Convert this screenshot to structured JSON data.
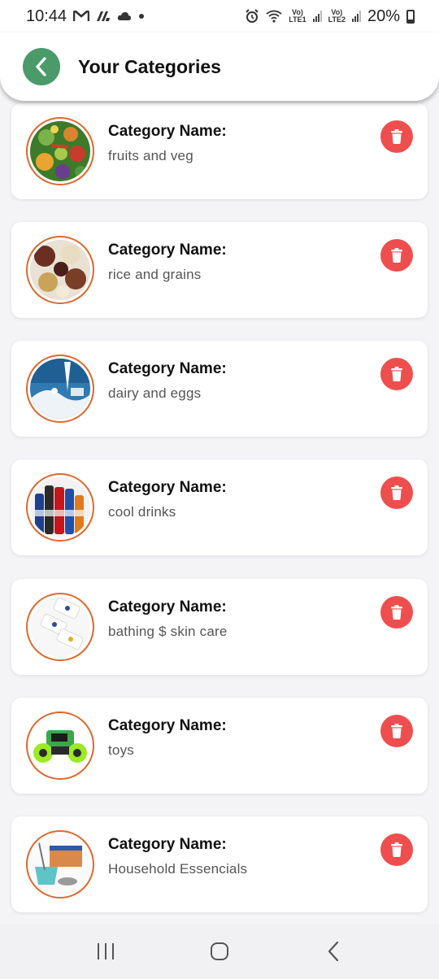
{
  "status_bar": {
    "time": "10:44",
    "left_icons": [
      "gmail-m-icon",
      "app-icon",
      "cloud-icon",
      "dot-icon"
    ],
    "sim1_label_top": "Vo)",
    "sim1_label_bottom": "LTE1",
    "sim2_label_top": "Vo)",
    "sim2_label_bottom": "LTE2",
    "battery": "20%"
  },
  "app_bar": {
    "title": "Your Categories",
    "back_icon": "chevron-left-icon",
    "accent_color": "#4a9a6a"
  },
  "categories": [
    {
      "label": "Category Name:",
      "name": "fruits and veg"
    },
    {
      "label": "Category Name:",
      "name": "rice and grains"
    },
    {
      "label": "Category Name:",
      "name": "dairy and eggs"
    },
    {
      "label": "Category Name:",
      "name": "cool drinks"
    },
    {
      "label": "Category Name:",
      "name": "bathing $ skin care"
    },
    {
      "label": "Category Name:",
      "name": "toys"
    },
    {
      "label": "Category Name:",
      "name": "Household Essencials"
    }
  ],
  "colors": {
    "delete": "#ef4e4e",
    "thumb_border": "#e0682c"
  },
  "nav_bar": {
    "icons": [
      "recent-apps-icon",
      "home-icon",
      "back-icon"
    ]
  }
}
